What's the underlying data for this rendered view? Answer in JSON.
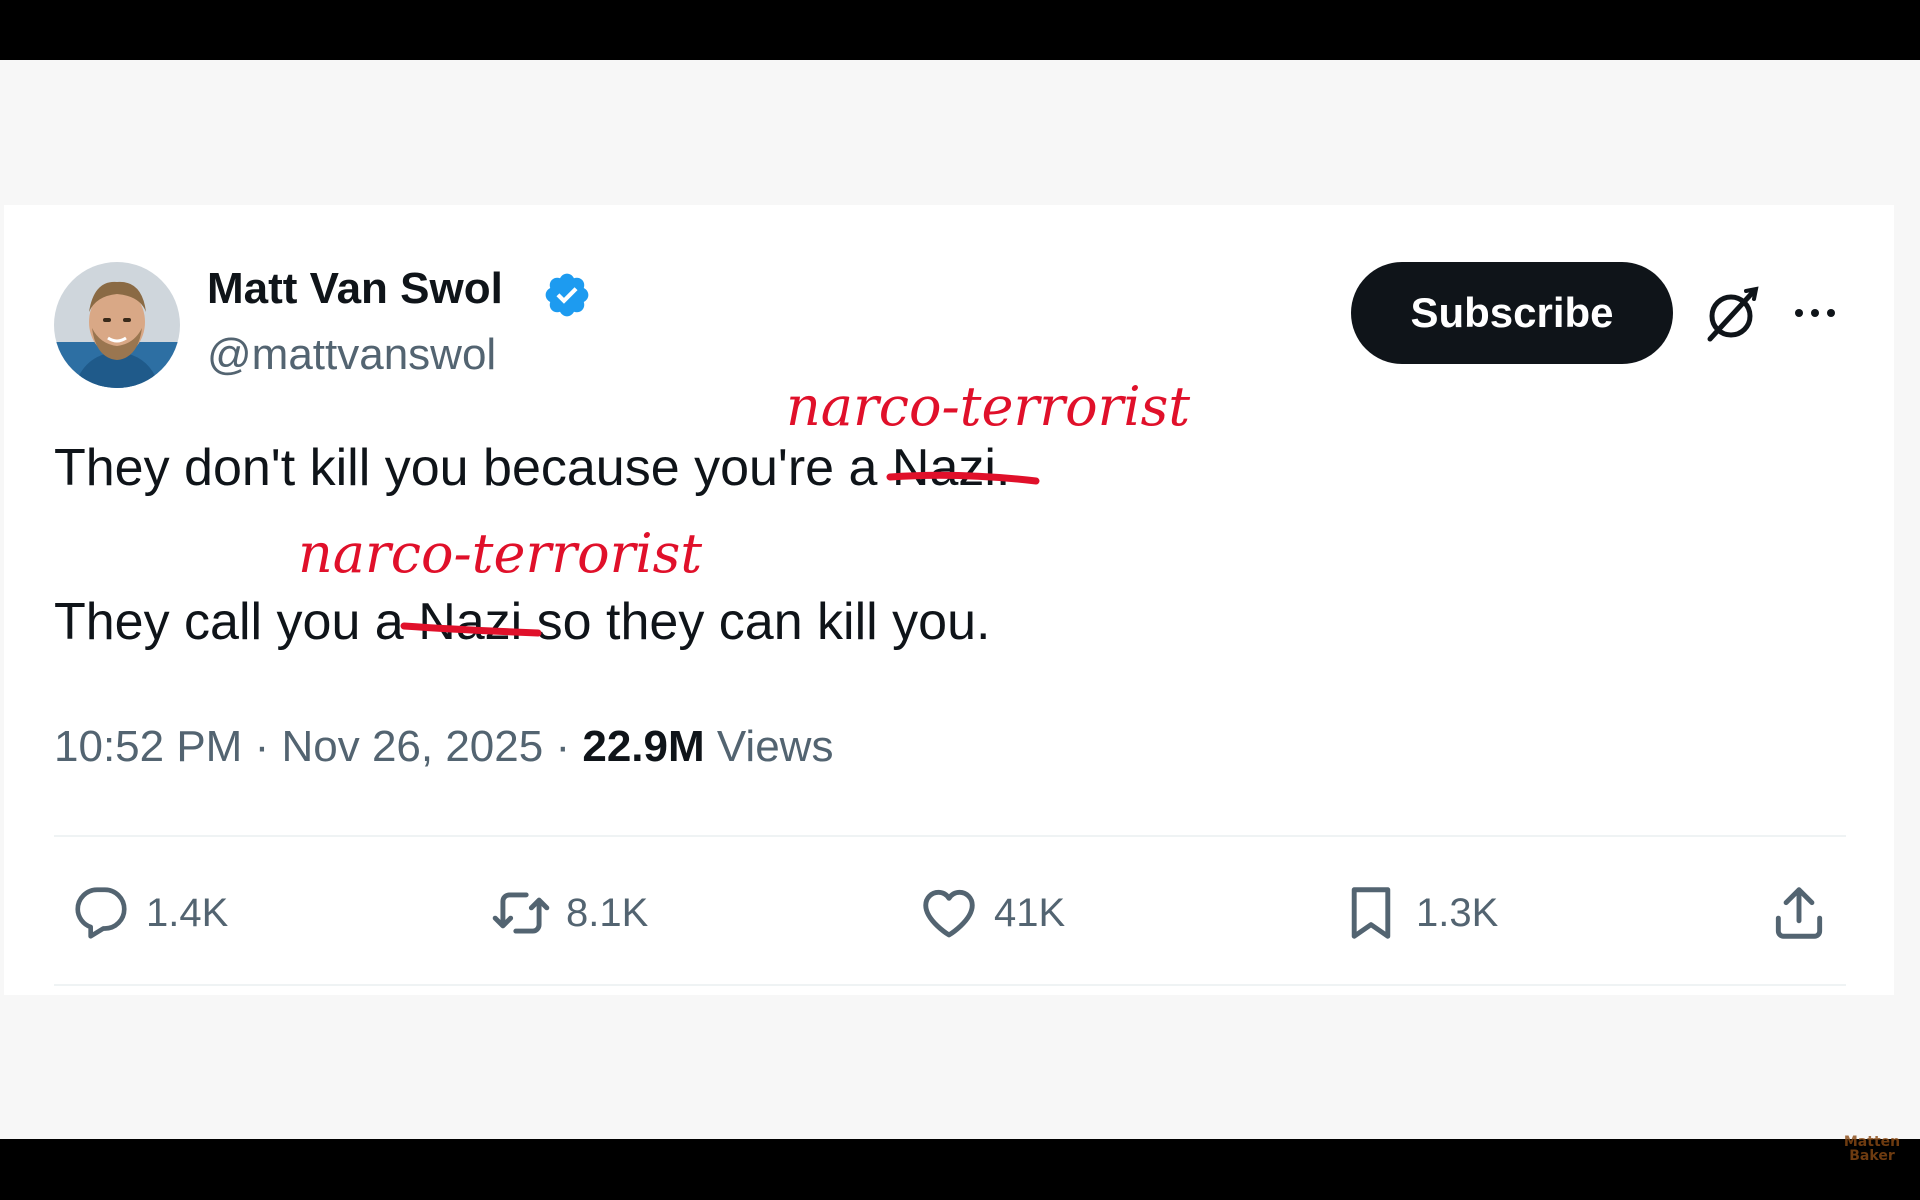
{
  "author": {
    "display_name": "Matt Van Swol",
    "handle": "@mattvanswol",
    "verified": true
  },
  "header_actions": {
    "subscribe_label": "Subscribe"
  },
  "tweet": {
    "line1_before": "They don't kill you because you're a ",
    "line1_struck": "Nazi.",
    "line2_before": "They call you a ",
    "line2_struck": "Nazi",
    "line2_after": " so they can kill you.",
    "annotation_1": "narco-terrorist",
    "annotation_2": "narco-terrorist"
  },
  "meta": {
    "time": "10:52 PM",
    "separator": "·",
    "date": "Nov 26, 2025",
    "views_count": "22.9M",
    "views_label": "Views"
  },
  "actions": {
    "replies": "1.4K",
    "retweets": "8.1K",
    "likes": "41K",
    "bookmarks": "1.3K"
  },
  "watermark": {
    "line1": "Matten",
    "line2": "Baker"
  },
  "colors": {
    "verified": "#1d9bf0",
    "annotation": "#e0102a",
    "text_primary": "#0f1419",
    "text_secondary": "#536471"
  }
}
